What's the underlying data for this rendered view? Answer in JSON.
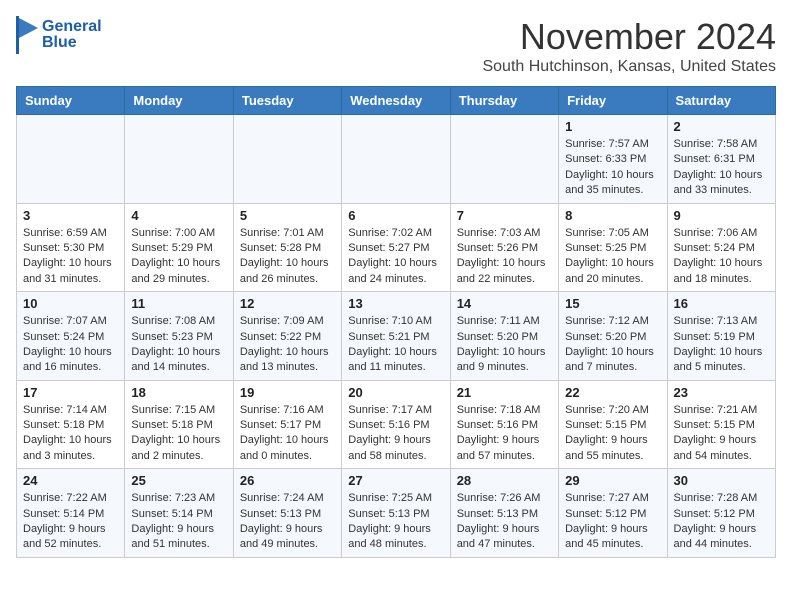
{
  "header": {
    "logo_line1": "General",
    "logo_line2": "Blue",
    "month": "November 2024",
    "location": "South Hutchinson, Kansas, United States"
  },
  "weekdays": [
    "Sunday",
    "Monday",
    "Tuesday",
    "Wednesday",
    "Thursday",
    "Friday",
    "Saturday"
  ],
  "weeks": [
    [
      {
        "day": "",
        "sunrise": "",
        "sunset": "",
        "daylight": ""
      },
      {
        "day": "",
        "sunrise": "",
        "sunset": "",
        "daylight": ""
      },
      {
        "day": "",
        "sunrise": "",
        "sunset": "",
        "daylight": ""
      },
      {
        "day": "",
        "sunrise": "",
        "sunset": "",
        "daylight": ""
      },
      {
        "day": "",
        "sunrise": "",
        "sunset": "",
        "daylight": ""
      },
      {
        "day": "1",
        "sunrise": "Sunrise: 7:57 AM",
        "sunset": "Sunset: 6:33 PM",
        "daylight": "Daylight: 10 hours and 35 minutes."
      },
      {
        "day": "2",
        "sunrise": "Sunrise: 7:58 AM",
        "sunset": "Sunset: 6:31 PM",
        "daylight": "Daylight: 10 hours and 33 minutes."
      }
    ],
    [
      {
        "day": "3",
        "sunrise": "Sunrise: 6:59 AM",
        "sunset": "Sunset: 5:30 PM",
        "daylight": "Daylight: 10 hours and 31 minutes."
      },
      {
        "day": "4",
        "sunrise": "Sunrise: 7:00 AM",
        "sunset": "Sunset: 5:29 PM",
        "daylight": "Daylight: 10 hours and 29 minutes."
      },
      {
        "day": "5",
        "sunrise": "Sunrise: 7:01 AM",
        "sunset": "Sunset: 5:28 PM",
        "daylight": "Daylight: 10 hours and 26 minutes."
      },
      {
        "day": "6",
        "sunrise": "Sunrise: 7:02 AM",
        "sunset": "Sunset: 5:27 PM",
        "daylight": "Daylight: 10 hours and 24 minutes."
      },
      {
        "day": "7",
        "sunrise": "Sunrise: 7:03 AM",
        "sunset": "Sunset: 5:26 PM",
        "daylight": "Daylight: 10 hours and 22 minutes."
      },
      {
        "day": "8",
        "sunrise": "Sunrise: 7:05 AM",
        "sunset": "Sunset: 5:25 PM",
        "daylight": "Daylight: 10 hours and 20 minutes."
      },
      {
        "day": "9",
        "sunrise": "Sunrise: 7:06 AM",
        "sunset": "Sunset: 5:24 PM",
        "daylight": "Daylight: 10 hours and 18 minutes."
      }
    ],
    [
      {
        "day": "10",
        "sunrise": "Sunrise: 7:07 AM",
        "sunset": "Sunset: 5:24 PM",
        "daylight": "Daylight: 10 hours and 16 minutes."
      },
      {
        "day": "11",
        "sunrise": "Sunrise: 7:08 AM",
        "sunset": "Sunset: 5:23 PM",
        "daylight": "Daylight: 10 hours and 14 minutes."
      },
      {
        "day": "12",
        "sunrise": "Sunrise: 7:09 AM",
        "sunset": "Sunset: 5:22 PM",
        "daylight": "Daylight: 10 hours and 13 minutes."
      },
      {
        "day": "13",
        "sunrise": "Sunrise: 7:10 AM",
        "sunset": "Sunset: 5:21 PM",
        "daylight": "Daylight: 10 hours and 11 minutes."
      },
      {
        "day": "14",
        "sunrise": "Sunrise: 7:11 AM",
        "sunset": "Sunset: 5:20 PM",
        "daylight": "Daylight: 10 hours and 9 minutes."
      },
      {
        "day": "15",
        "sunrise": "Sunrise: 7:12 AM",
        "sunset": "Sunset: 5:20 PM",
        "daylight": "Daylight: 10 hours and 7 minutes."
      },
      {
        "day": "16",
        "sunrise": "Sunrise: 7:13 AM",
        "sunset": "Sunset: 5:19 PM",
        "daylight": "Daylight: 10 hours and 5 minutes."
      }
    ],
    [
      {
        "day": "17",
        "sunrise": "Sunrise: 7:14 AM",
        "sunset": "Sunset: 5:18 PM",
        "daylight": "Daylight: 10 hours and 3 minutes."
      },
      {
        "day": "18",
        "sunrise": "Sunrise: 7:15 AM",
        "sunset": "Sunset: 5:18 PM",
        "daylight": "Daylight: 10 hours and 2 minutes."
      },
      {
        "day": "19",
        "sunrise": "Sunrise: 7:16 AM",
        "sunset": "Sunset: 5:17 PM",
        "daylight": "Daylight: 10 hours and 0 minutes."
      },
      {
        "day": "20",
        "sunrise": "Sunrise: 7:17 AM",
        "sunset": "Sunset: 5:16 PM",
        "daylight": "Daylight: 9 hours and 58 minutes."
      },
      {
        "day": "21",
        "sunrise": "Sunrise: 7:18 AM",
        "sunset": "Sunset: 5:16 PM",
        "daylight": "Daylight: 9 hours and 57 minutes."
      },
      {
        "day": "22",
        "sunrise": "Sunrise: 7:20 AM",
        "sunset": "Sunset: 5:15 PM",
        "daylight": "Daylight: 9 hours and 55 minutes."
      },
      {
        "day": "23",
        "sunrise": "Sunrise: 7:21 AM",
        "sunset": "Sunset: 5:15 PM",
        "daylight": "Daylight: 9 hours and 54 minutes."
      }
    ],
    [
      {
        "day": "24",
        "sunrise": "Sunrise: 7:22 AM",
        "sunset": "Sunset: 5:14 PM",
        "daylight": "Daylight: 9 hours and 52 minutes."
      },
      {
        "day": "25",
        "sunrise": "Sunrise: 7:23 AM",
        "sunset": "Sunset: 5:14 PM",
        "daylight": "Daylight: 9 hours and 51 minutes."
      },
      {
        "day": "26",
        "sunrise": "Sunrise: 7:24 AM",
        "sunset": "Sunset: 5:13 PM",
        "daylight": "Daylight: 9 hours and 49 minutes."
      },
      {
        "day": "27",
        "sunrise": "Sunrise: 7:25 AM",
        "sunset": "Sunset: 5:13 PM",
        "daylight": "Daylight: 9 hours and 48 minutes."
      },
      {
        "day": "28",
        "sunrise": "Sunrise: 7:26 AM",
        "sunset": "Sunset: 5:13 PM",
        "daylight": "Daylight: 9 hours and 47 minutes."
      },
      {
        "day": "29",
        "sunrise": "Sunrise: 7:27 AM",
        "sunset": "Sunset: 5:12 PM",
        "daylight": "Daylight: 9 hours and 45 minutes."
      },
      {
        "day": "30",
        "sunrise": "Sunrise: 7:28 AM",
        "sunset": "Sunset: 5:12 PM",
        "daylight": "Daylight: 9 hours and 44 minutes."
      }
    ]
  ]
}
